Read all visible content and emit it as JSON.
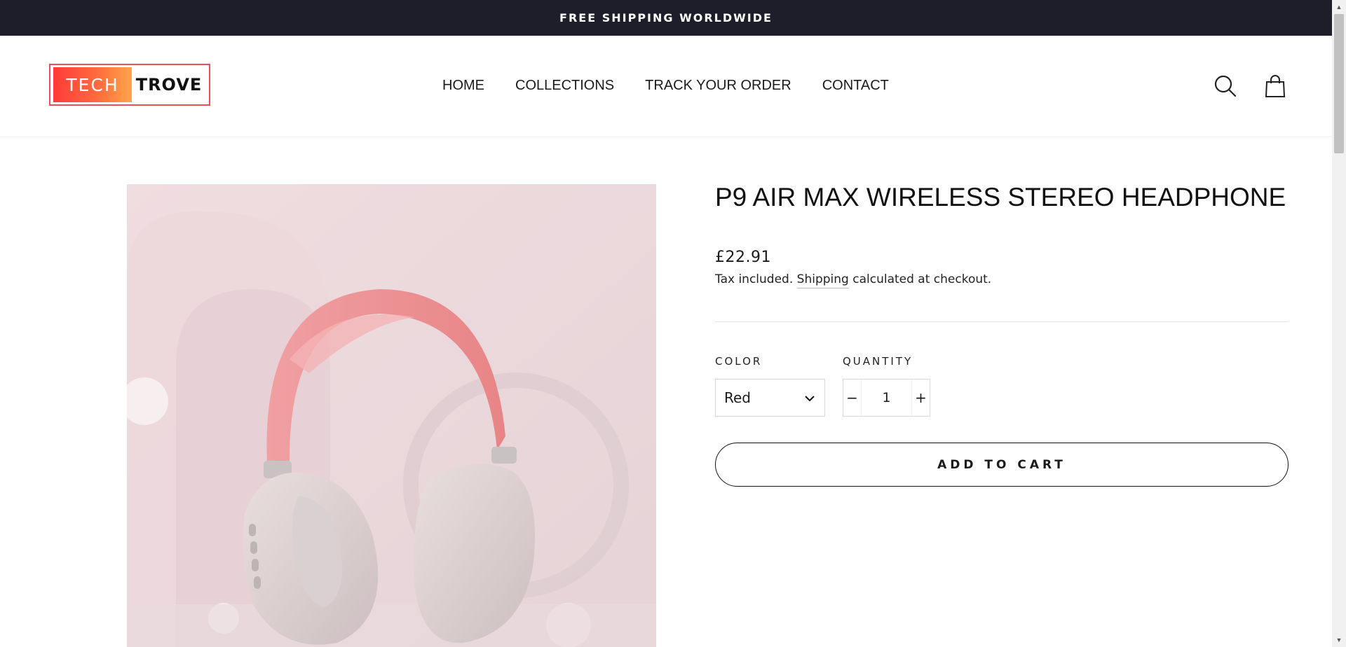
{
  "announcement": "FREE SHIPPING WORLDWIDE",
  "logo": {
    "left": "TECH",
    "right": "TROVE"
  },
  "nav": [
    "HOME",
    "COLLECTIONS",
    "TRACK YOUR ORDER",
    "CONTACT"
  ],
  "header_icons": [
    "search-icon",
    "shopping-bag-icon"
  ],
  "product": {
    "title": "P9 AIR MAX WIRELESS STEREO HEADPHONE",
    "price": "£22.91",
    "tax_prefix": "Tax included.",
    "tax_link": "Shipping",
    "tax_suffix": "calculated at checkout.",
    "color_label": "COLOR",
    "color_value": "Red",
    "quantity_label": "QUANTITY",
    "quantity_value": "1",
    "qty_minus": "−",
    "qty_plus": "+",
    "add_to_cart": "ADD TO CART"
  },
  "colors": {
    "announcement_bg": "#1e1e2a",
    "logo_accent": "#e8505b",
    "headband": "#ec8d8f",
    "image_bg": "#ead6da"
  }
}
